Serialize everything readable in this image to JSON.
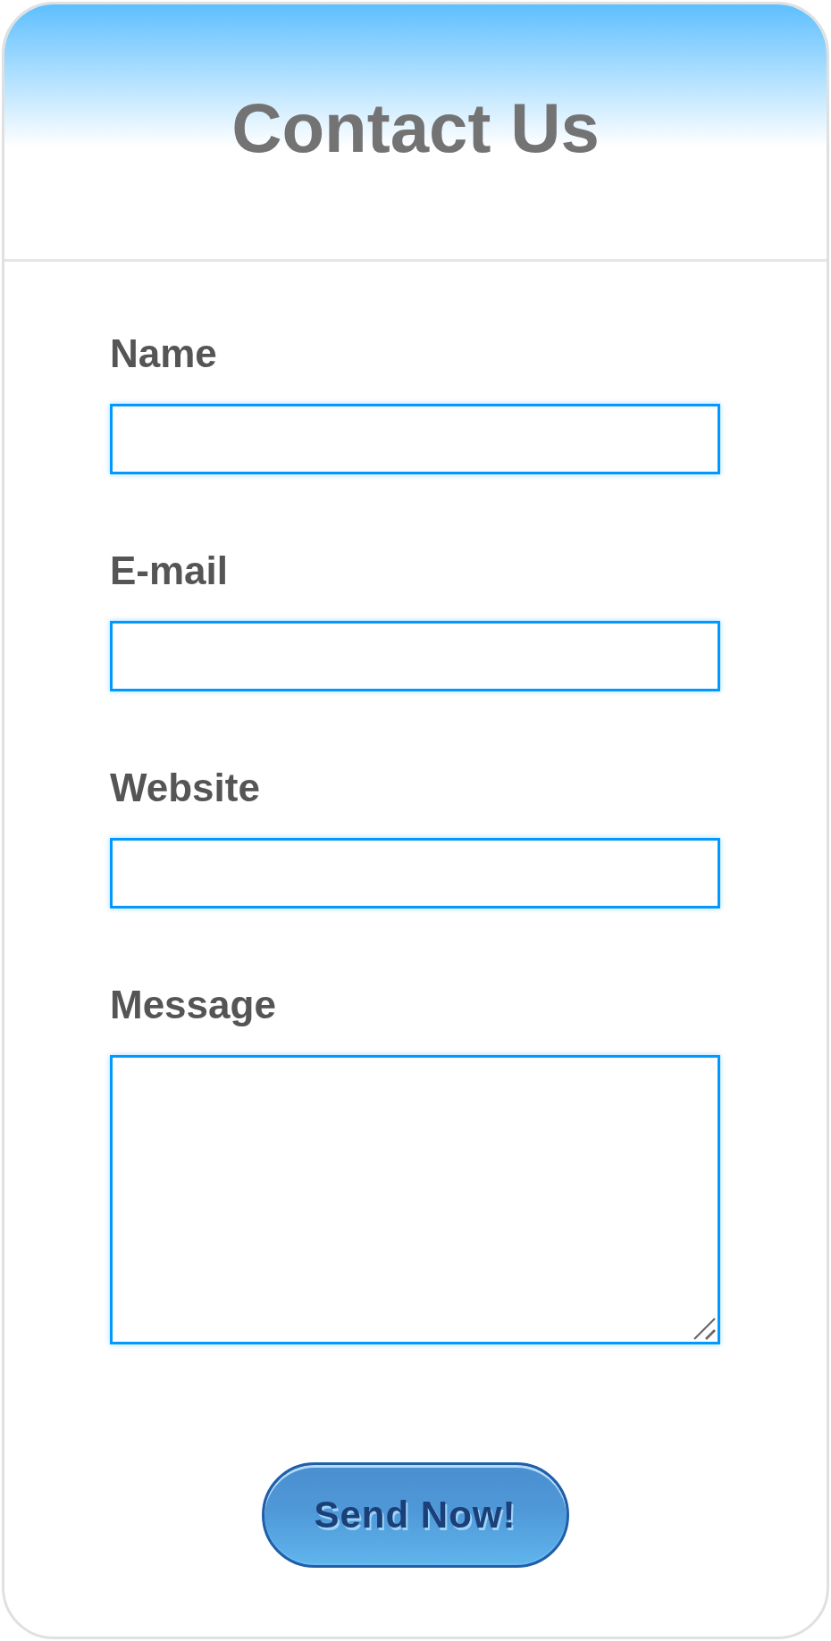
{
  "header": {
    "title": "Contact Us"
  },
  "fields": [
    {
      "label": "Name",
      "kind": "text"
    },
    {
      "label": "E-mail",
      "kind": "text"
    },
    {
      "label": "Website",
      "kind": "text"
    },
    {
      "label": "Message",
      "kind": "textarea"
    }
  ],
  "submit_button": {
    "label": "Send Now!"
  }
}
